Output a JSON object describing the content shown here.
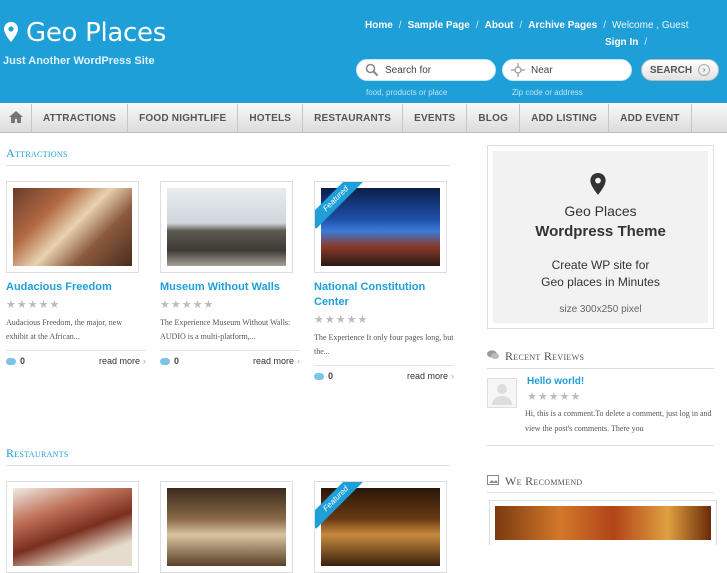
{
  "header": {
    "site_title": "Geo Places",
    "tagline": "Just Another WordPress Site",
    "top_nav": {
      "home": "Home",
      "sample_page": "Sample Page",
      "about": "About",
      "archive_pages": "Archive Pages",
      "welcome": "Welcome , Guest",
      "sign_in": "Sign In",
      "separator": "/"
    },
    "search": {
      "what_placeholder": "Search for",
      "what_hint": "food, products or place",
      "near_placeholder": "Near",
      "near_hint": "Zip code or address",
      "button_label": "SEARCH"
    }
  },
  "main_nav": [
    "ATTRACTIONS",
    "FOOD NIGHTLIFE",
    "HOTELS",
    "RESTAURANTS",
    "EVENTS",
    "BLOG",
    "ADD LISTING",
    "ADD EVENT"
  ],
  "attractions": {
    "heading": "Attractions",
    "cards": [
      {
        "title": "Audacious Freedom",
        "excerpt": "Audacious Freedom, the major, new exhibit at the African...",
        "comments": "0",
        "more": "read more",
        "featured": false
      },
      {
        "title": "Museum Without Walls",
        "excerpt": "The Experience Museum Without Walls: AUDIO is a multi-platform,...",
        "comments": "0",
        "more": "read more",
        "featured": false
      },
      {
        "title": "National Constitution Center",
        "excerpt": "The Experience It only four pages long, but the...",
        "comments": "0",
        "more": "read more",
        "featured": true
      }
    ]
  },
  "restaurants": {
    "heading": "Restaurants"
  },
  "featured_label": "Featured",
  "stars": "★★★★★",
  "sidebar": {
    "ad": {
      "line1": "Geo Places",
      "line2": "Wordpress Theme",
      "line3": "Create WP site for",
      "line4": "Geo places in Minutes",
      "size": "size 300x250 pixel"
    },
    "recent_reviews_title": "Recent Reviews",
    "review": {
      "title": "Hello world!",
      "text": "Hi, this is a comment.To delete a comment, just log in and view the post's comments. There you"
    },
    "recommend_title": "We Recommend"
  },
  "colors": {
    "brand_blue": "#1e9fd8",
    "nav_bg": "#e8e8e8"
  }
}
